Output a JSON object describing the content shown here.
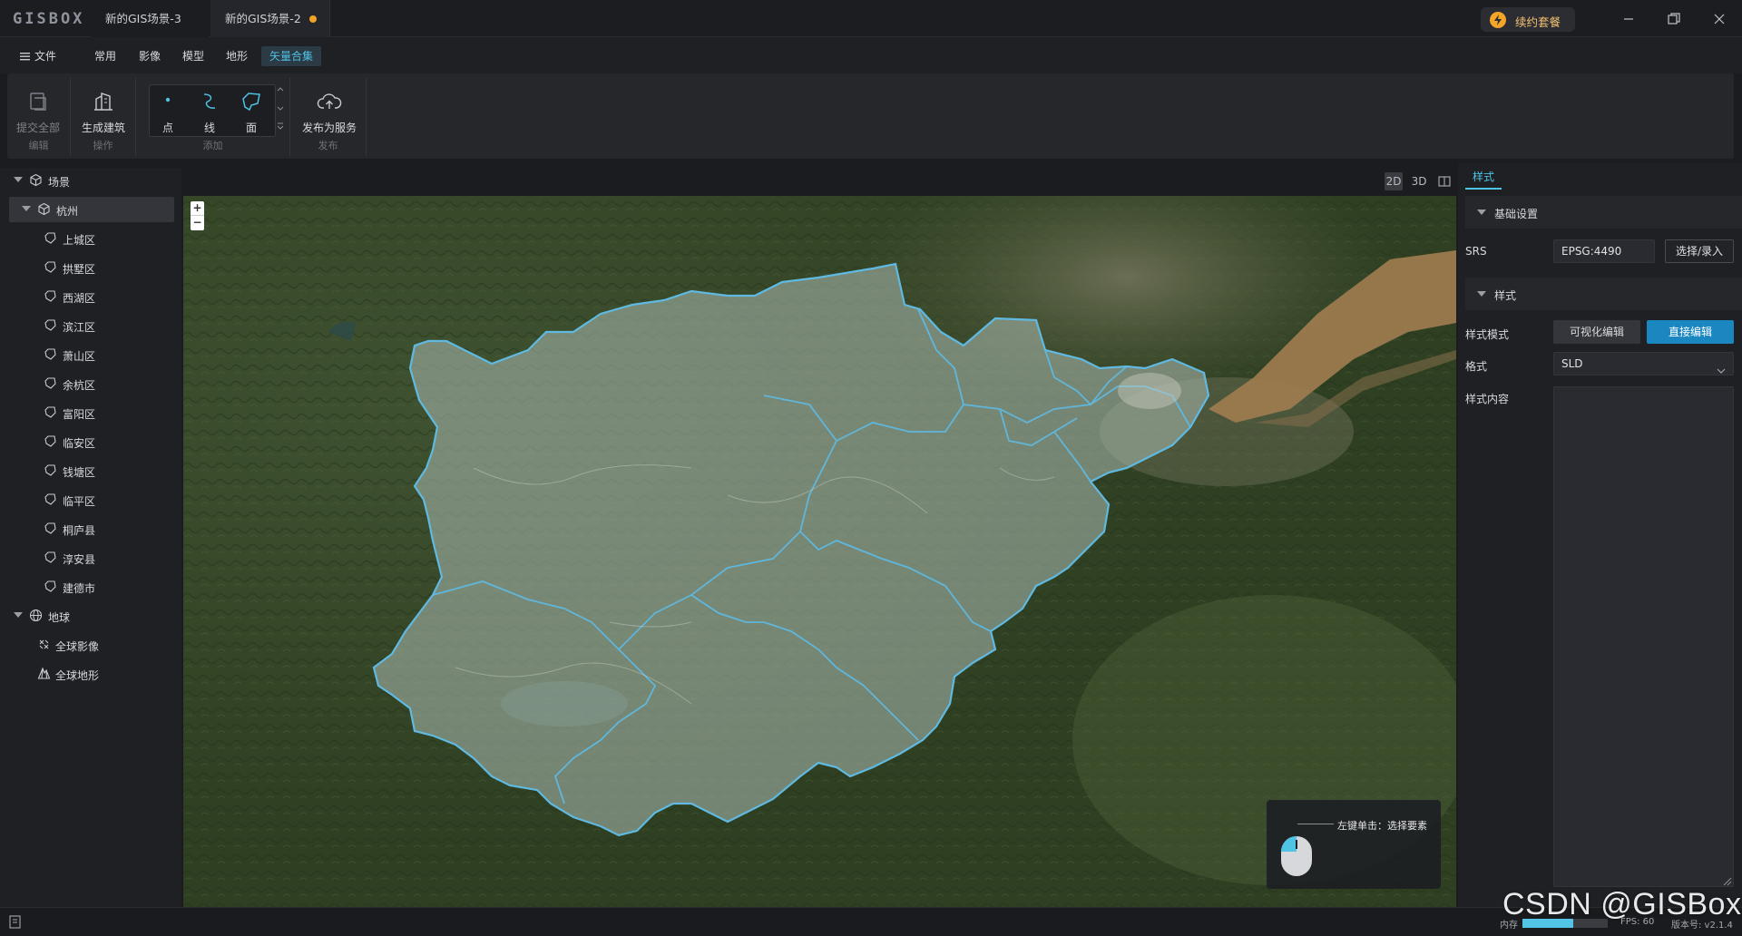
{
  "app": {
    "logo": "GISBOX"
  },
  "tabs": [
    {
      "label": "新的GIS场景-3"
    },
    {
      "label": "新的GIS场景-2",
      "unsaved": true
    }
  ],
  "renew": {
    "label": "续约套餐"
  },
  "menu": {
    "file": "文件",
    "items": [
      "常用",
      "影像",
      "模型",
      "地形",
      "矢量合集"
    ],
    "active": "矢量合集"
  },
  "ribbon": {
    "groups": [
      {
        "caption": "编辑",
        "buttons": [
          {
            "label": "提交全部",
            "icon": "submit-all-icon",
            "disabled": true
          }
        ]
      },
      {
        "caption": "操作",
        "buttons": [
          {
            "label": "生成建筑",
            "icon": "building-icon"
          }
        ]
      },
      {
        "caption": "添加",
        "buttons": [
          {
            "label": "点",
            "icon": "point-icon"
          },
          {
            "label": "线",
            "icon": "line-icon"
          },
          {
            "label": "面",
            "icon": "polygon-icon"
          }
        ]
      },
      {
        "caption": "发布",
        "buttons": [
          {
            "label": "发布为服务",
            "icon": "cloud-upload-icon"
          }
        ]
      }
    ]
  },
  "tree": {
    "scene": {
      "label": "场景",
      "icon": "cube-icon"
    },
    "city": {
      "label": "杭州",
      "icon": "cube-icon"
    },
    "districts": [
      "上城区",
      "拱墅区",
      "西湖区",
      "滨江区",
      "萧山区",
      "余杭区",
      "富阳区",
      "临安区",
      "钱塘区",
      "临平区",
      "桐庐县",
      "淳安县",
      "建德市"
    ],
    "earth": {
      "label": "地球",
      "icon": "globe-icon"
    },
    "earth_children": [
      {
        "label": "全球影像",
        "icon": "imagery-icon"
      },
      {
        "label": "全球地形",
        "icon": "terrain-icon"
      }
    ]
  },
  "viewmodes": {
    "items": [
      "2D",
      "3D",
      "split-view-icon"
    ],
    "active": "2D"
  },
  "map": {
    "zoom_in": "+",
    "zoom_out": "−",
    "hint": "左键单击：选择要素"
  },
  "panel": {
    "tab": "样式",
    "basic_section": "基础设置",
    "srs_label": "SRS",
    "srs_value": "EPSG:4490",
    "srs_button": "选择/录入",
    "style_section": "样式",
    "mode_label": "样式模式",
    "mode_visual": "可视化编辑",
    "mode_direct": "直接编辑",
    "format_label": "格式",
    "format_value": "SLD",
    "content_label": "样式内容",
    "content_value": ""
  },
  "status": {
    "memory_label": "内存",
    "memory_fraction": 0.6,
    "fps": "FPS: 60",
    "version": "版本号: v2.1.4"
  },
  "watermark": "CSDN @GISBox",
  "colors": {
    "accent": "#4ec3e4",
    "primary_button": "#1b87c0",
    "unsaved_dot": "#f0a324",
    "boundary": "#5fb9e0"
  }
}
